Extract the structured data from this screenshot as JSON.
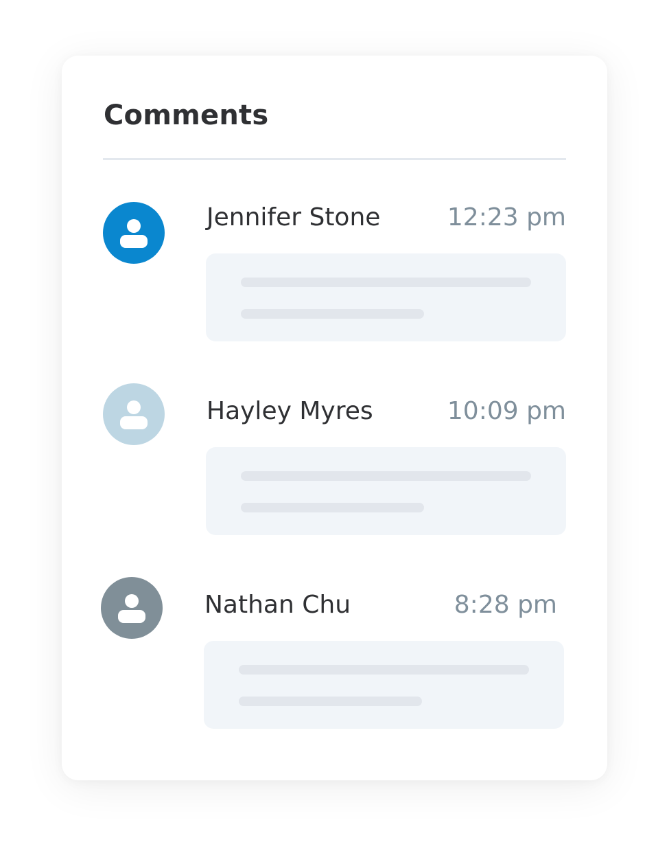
{
  "panel": {
    "title": "Comments"
  },
  "colors": {
    "avatar_active": "#0a87cf",
    "avatar_light": "#bdd6e3",
    "avatar_gray": "#808f98",
    "bubble_bg": "#f1f5f9",
    "placeholder_line": "#e2e6ec",
    "time_text": "#7f8f9b"
  },
  "comments": [
    {
      "name": "Jennifer Stone",
      "time": "12:23 pm",
      "avatar_icon": "user-icon"
    },
    {
      "name": "Hayley Myres",
      "time": "10:09 pm",
      "avatar_icon": "user-icon"
    },
    {
      "name": "Nathan Chu",
      "time": "8:28 pm",
      "avatar_icon": "user-icon"
    }
  ]
}
